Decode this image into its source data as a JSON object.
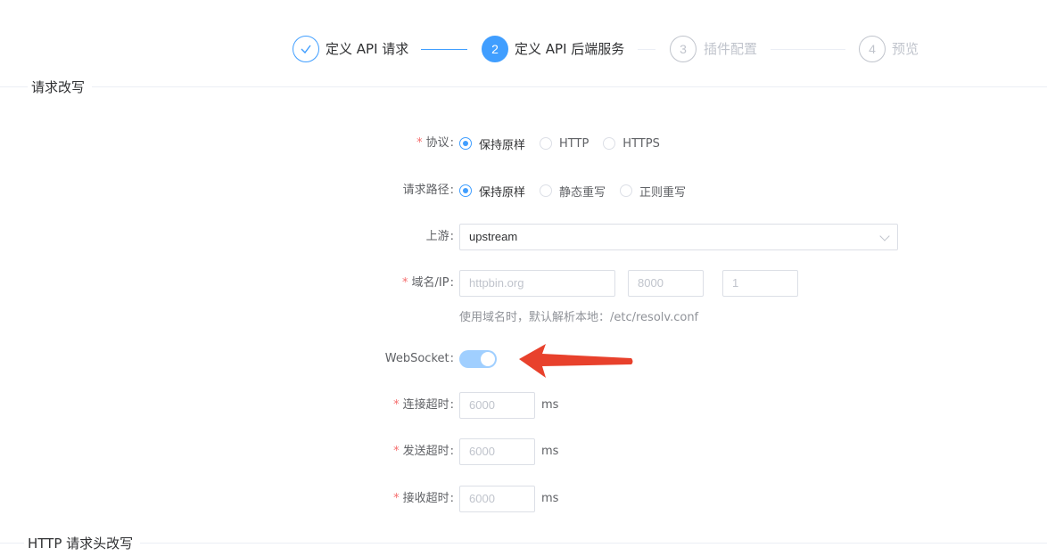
{
  "steps": [
    {
      "index": "1",
      "title": "定义 API 请求",
      "status": "done"
    },
    {
      "index": "2",
      "title": "定义 API 后端服务",
      "status": "active"
    },
    {
      "index": "3",
      "title": "插件配置",
      "status": "wait"
    },
    {
      "index": "4",
      "title": "预览",
      "status": "wait"
    }
  ],
  "sections": {
    "request_rewrite": "请求改写",
    "header_rewrite": "HTTP 请求头改写"
  },
  "form": {
    "protocol": {
      "label": "协议",
      "required": true,
      "options": [
        "保持原样",
        "HTTP",
        "HTTPS"
      ],
      "selected": "保持原样"
    },
    "path": {
      "label": "请求路径",
      "required": false,
      "options": [
        "保持原样",
        "静态重写",
        "正则重写"
      ],
      "selected": "保持原样"
    },
    "upstream": {
      "label": "上游",
      "value": "upstream"
    },
    "domain": {
      "label": "域名/IP",
      "required": true,
      "host_placeholder": "httpbin.org",
      "port_placeholder": "8000",
      "weight_placeholder": "1",
      "hint": "使用域名时，默认解析本地：/etc/resolv.conf"
    },
    "websocket": {
      "label": "WebSocket",
      "enabled": true
    },
    "connect_timeout": {
      "label": "连接超时",
      "placeholder": "6000",
      "unit": "ms"
    },
    "send_timeout": {
      "label": "发送超时",
      "placeholder": "6000",
      "unit": "ms"
    },
    "receive_timeout": {
      "label": "接收超时",
      "placeholder": "6000",
      "unit": "ms"
    }
  },
  "colors": {
    "primary": "#409eff",
    "required": "#f56c6c",
    "annotation_arrow": "#e8412c"
  },
  "icons": {
    "step_done": "check-icon",
    "select": "chevron-down-icon",
    "annotation": "arrow-left-icon"
  }
}
